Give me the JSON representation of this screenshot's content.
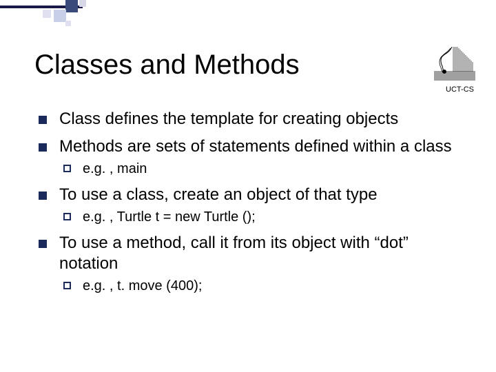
{
  "header": {
    "title": "Classes and Methods",
    "tag": "UCT-CS"
  },
  "bullets": [
    {
      "text": "Class defines the template for creating objects",
      "sub": []
    },
    {
      "text": "Methods are sets of statements defined within a class",
      "sub": [
        {
          "label": "e.g. ,",
          "rest": " main"
        }
      ]
    },
    {
      "text": "To use a class, create an object of that type",
      "sub": [
        {
          "label": "e.g. ,",
          "rest": " Turtle t = new Turtle ();"
        }
      ]
    },
    {
      "text": "To use a method, call it from its object with “dot” notation",
      "sub": [
        {
          "label": "e.g. ,",
          "rest": " t. move (400);"
        }
      ]
    }
  ]
}
